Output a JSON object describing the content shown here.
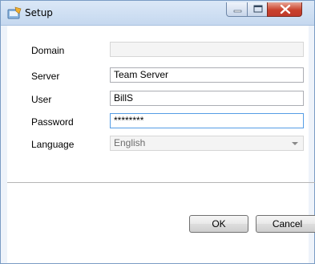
{
  "window": {
    "title": "Setup"
  },
  "form": {
    "domain": {
      "label": "Domain",
      "value": ""
    },
    "server": {
      "label": "Server",
      "value": "Team Server"
    },
    "user": {
      "label": "User",
      "value": "BillS"
    },
    "password": {
      "label": "Password",
      "value": "********"
    },
    "language": {
      "label": "Language",
      "value": "English"
    }
  },
  "buttons": {
    "ok": "OK",
    "cancel": "Cancel"
  },
  "colors": {
    "close_button": "#c9422d",
    "titlebar": "#c5d8ef",
    "focus_border": "#569de5"
  }
}
